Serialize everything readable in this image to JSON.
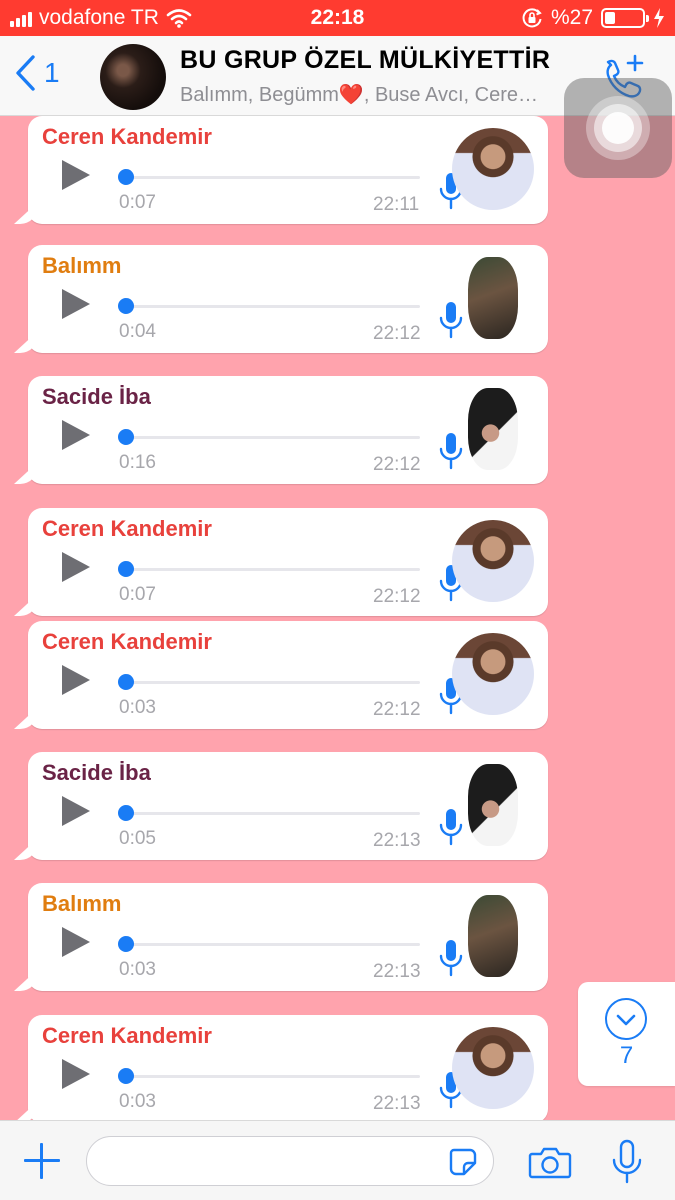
{
  "status_bar": {
    "carrier": "vodafone TR",
    "time": "22:18",
    "battery_text": "%27",
    "battery_level": 0.27
  },
  "header": {
    "back_count": "1",
    "title": "BU GRUP ÖZEL MÜLKİYETTİR",
    "subtitle": "Balımm, Begümm❤️, Buse Avcı, Cere…"
  },
  "messages": [
    {
      "sender": "Ceren Kandemir",
      "color": "#e8413c",
      "duration": "0:07",
      "time": "22:11",
      "avatar": "ceren"
    },
    {
      "sender": "Balımm",
      "color": "#e07d10",
      "duration": "0:04",
      "time": "22:12",
      "avatar": "balimm"
    },
    {
      "sender": "Sacide İba",
      "color": "#6a2346",
      "duration": "0:16",
      "time": "22:12",
      "avatar": "sacide"
    },
    {
      "sender": "Ceren Kandemir",
      "color": "#e8413c",
      "duration": "0:07",
      "time": "22:12",
      "avatar": "ceren"
    },
    {
      "sender": "Ceren Kandemir",
      "color": "#e8413c",
      "duration": "0:03",
      "time": "22:12",
      "avatar": "ceren"
    },
    {
      "sender": "Sacide İba",
      "color": "#6a2346",
      "duration": "0:05",
      "time": "22:13",
      "avatar": "sacide"
    },
    {
      "sender": "Balımm",
      "color": "#e07d10",
      "duration": "0:03",
      "time": "22:13",
      "avatar": "balimm"
    },
    {
      "sender": "Ceren Kandemir",
      "color": "#e8413c",
      "duration": "0:03",
      "time": "22:13",
      "avatar": "ceren"
    }
  ],
  "scroll_down": {
    "unread_count": "7"
  },
  "input": {
    "placeholder": ""
  },
  "colors": {
    "status_bar": "#ff3b30",
    "chat_background": "#ffa3ad",
    "accent": "#1a7cf5"
  }
}
